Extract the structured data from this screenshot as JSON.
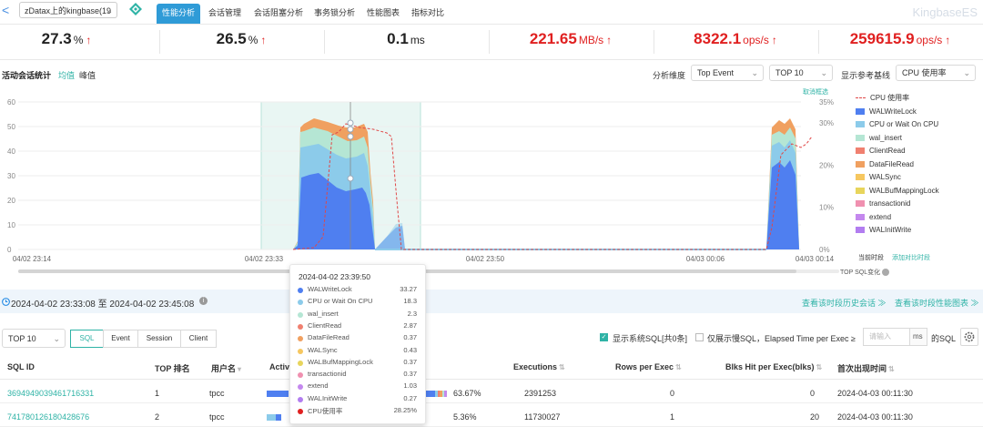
{
  "nav": {
    "back_glyph": "<",
    "db_select": "zDatax上的kingbase(19",
    "tabs": [
      "性能分析",
      "会话管理",
      "会话阻塞分析",
      "事务锁分析",
      "性能图表",
      "指标对比"
    ],
    "active_tab": 0,
    "brand": "KingbaseES"
  },
  "metrics": [
    {
      "value": "27.3",
      "unit": "%",
      "trend": "up",
      "color": "#222222"
    },
    {
      "value": "26.5",
      "unit": "%",
      "trend": "up",
      "color": "#222222"
    },
    {
      "value": "0.1",
      "unit": "ms",
      "trend": "",
      "color": "#222222"
    },
    {
      "value": "221.65",
      "unit": "MB/s",
      "trend": "up",
      "color": "#e02020"
    },
    {
      "value": "8322.1",
      "unit": "ops/s",
      "trend": "up",
      "color": "#e02020"
    },
    {
      "value": "259615.9",
      "unit": "ops/s",
      "trend": "up",
      "color": "#e02020"
    }
  ],
  "chart_header": {
    "title": "活动会话统计",
    "avg": "均值",
    "peak": "峰值",
    "dimension_label": "分析维度",
    "dimension_value": "Top  Event",
    "top_value": "TOP 10",
    "baseline_label": "显示参考基线",
    "baseline_value": "CPU 使用率",
    "cancel_select": "取消框选"
  },
  "chart_data": {
    "type": "area",
    "x_ticks": [
      "04/02 23:14",
      "04/02 23:33",
      "04/02 23:50",
      "04/03 00:06",
      "04/03 00:14"
    ],
    "y_left_ticks": [
      0,
      10,
      20,
      30,
      40,
      50,
      60
    ],
    "y_right_ticks": [
      "0%",
      "10%",
      "20%",
      "30%",
      "35%"
    ],
    "ylim_left": [
      0,
      60
    ],
    "ylim_right_percent": [
      0,
      35
    ],
    "legend_position": "right",
    "baseline_series": "CPU 使用率",
    "series": [
      {
        "name": "WALWriteLock",
        "color": "#4f7ff0"
      },
      {
        "name": "CPU or Wait On CPU",
        "color": "#8ccbea"
      },
      {
        "name": "wal_insert",
        "color": "#b5e6d4"
      },
      {
        "name": "ClientRead",
        "color": "#f08070"
      },
      {
        "name": "DataFileRead",
        "color": "#f0a060"
      },
      {
        "name": "WALSync",
        "color": "#f6c760"
      },
      {
        "name": "WALBufMappingLock",
        "color": "#e8d55c"
      },
      {
        "name": "transactionid",
        "color": "#f090b0"
      },
      {
        "name": "extend",
        "color": "#c488ee"
      },
      {
        "name": "WALInitWrite",
        "color": "#b27df0"
      }
    ],
    "legend_first": "CPU 使用率",
    "current_period": "当前时段",
    "add_compare": "添加对比时段",
    "top_sql_change": "TOP SQL变化"
  },
  "tooltip": {
    "time": "2024-04-02 23:39:50",
    "rows": [
      {
        "name": "WALWriteLock",
        "value": "33.27",
        "color": "#4f7ff0"
      },
      {
        "name": "CPU or Wait On CPU",
        "value": "18.3",
        "color": "#8ccbea"
      },
      {
        "name": "wal_insert",
        "value": "2.3",
        "color": "#b5e6d4"
      },
      {
        "name": "ClientRead",
        "value": "2.87",
        "color": "#f08070"
      },
      {
        "name": "DataFileRead",
        "value": "0.37",
        "color": "#f0a060"
      },
      {
        "name": "WALSync",
        "value": "0.43",
        "color": "#f6c760"
      },
      {
        "name": "WALBufMappingLock",
        "value": "0.37",
        "color": "#e8d55c"
      },
      {
        "name": "transactionid",
        "value": "0.37",
        "color": "#f090b0"
      },
      {
        "name": "extend",
        "value": "1.03",
        "color": "#c488ee"
      },
      {
        "name": "WALInitWrite",
        "value": "0.27",
        "color": "#b27df0"
      },
      {
        "name": "CPU使用率",
        "value": "28.25%",
        "color": "#e02020"
      }
    ]
  },
  "range": {
    "start": "2024-04-02 23:33:08",
    "to": "至",
    "end": "2024-04-02 23:45:08",
    "history_link": "查看该时段历史会话 ≫",
    "perf_link": "查看该时段性能图表 ≫"
  },
  "filters": {
    "top": "TOP 10",
    "types": [
      "SQL",
      "Event",
      "Session",
      "Client"
    ],
    "active_type": 0,
    "show_sys_sql": "显示系统SQL[共0条]",
    "slow_only": "仅展示慢SQL，Elapsed Time per Exec ≥",
    "input_placeholder": "请输入",
    "unit": "ms",
    "suffix": "的SQL"
  },
  "table": {
    "headers": [
      "SQL ID",
      "TOP 排名",
      "用户名",
      "Activi",
      "Executions",
      "Rows per Exec",
      "Blks Hit per Exec(blks)",
      "首次出现时间"
    ],
    "rows": [
      {
        "sql_id": "3694949039461716331",
        "rank": "1",
        "user": "tpcc",
        "activity": "63.67%",
        "executions": "2391253",
        "rows": "0",
        "blks": "0",
        "first": "2024-04-03 00:11:30",
        "share": 0.6367
      },
      {
        "sql_id": "741780126180428676",
        "rank": "2",
        "user": "tpcc",
        "activity": "5.36%",
        "executions": "11730027",
        "rows": "1",
        "blks": "20",
        "first": "2024-04-03 00:11:30",
        "share": 0.0536
      }
    ]
  }
}
